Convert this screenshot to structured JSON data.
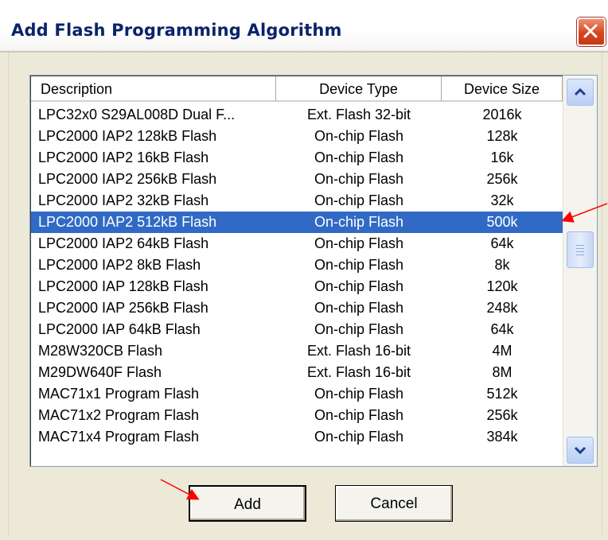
{
  "window": {
    "title": "Add Flash Programming Algorithm"
  },
  "columns": {
    "description": "Description",
    "device_type": "Device Type",
    "device_size": "Device Size"
  },
  "rows": [
    {
      "description": "LPC32x0 S29AL008D Dual F...",
      "type": "Ext. Flash 32-bit",
      "size": "2016k"
    },
    {
      "description": "LPC2000 IAP2 128kB Flash",
      "type": "On-chip Flash",
      "size": "128k"
    },
    {
      "description": "LPC2000 IAP2 16kB Flash",
      "type": "On-chip Flash",
      "size": "16k"
    },
    {
      "description": "LPC2000 IAP2 256kB Flash",
      "type": "On-chip Flash",
      "size": "256k"
    },
    {
      "description": "LPC2000 IAP2 32kB Flash",
      "type": "On-chip Flash",
      "size": "32k"
    },
    {
      "description": "LPC2000 IAP2 512kB Flash",
      "type": "On-chip Flash",
      "size": "500k"
    },
    {
      "description": "LPC2000 IAP2 64kB Flash",
      "type": "On-chip Flash",
      "size": "64k"
    },
    {
      "description": "LPC2000 IAP2 8kB Flash",
      "type": "On-chip Flash",
      "size": "8k"
    },
    {
      "description": "LPC2000 IAP 128kB Flash",
      "type": "On-chip Flash",
      "size": "120k"
    },
    {
      "description": "LPC2000 IAP 256kB Flash",
      "type": "On-chip Flash",
      "size": "248k"
    },
    {
      "description": "LPC2000 IAP 64kB Flash",
      "type": "On-chip Flash",
      "size": "64k"
    },
    {
      "description": "M28W320CB Flash",
      "type": "Ext. Flash 16-bit",
      "size": "4M"
    },
    {
      "description": "M29DW640F Flash",
      "type": "Ext. Flash 16-bit",
      "size": "8M"
    },
    {
      "description": "MAC71x1 Program Flash",
      "type": "On-chip Flash",
      "size": "512k"
    },
    {
      "description": "MAC71x2 Program Flash",
      "type": "On-chip Flash",
      "size": "256k"
    },
    {
      "description": "MAC71x4 Program Flash",
      "type": "On-chip Flash",
      "size": "384k"
    }
  ],
  "selected_row": "LPC2000 IAP2 512kB Flash",
  "buttons": {
    "add": "Add",
    "cancel": "Cancel"
  },
  "icons": {
    "close": "close-icon",
    "scroll_up": "chevron-up-icon",
    "scroll_down": "chevron-down-icon",
    "annotation": "red-arrow-icon"
  },
  "colors": {
    "title": "#0a246a",
    "selection": "#316ac5",
    "close_button": "#d8441e",
    "annotation_arrow": "#ff0000",
    "dialog_face": "#ece9d8"
  }
}
